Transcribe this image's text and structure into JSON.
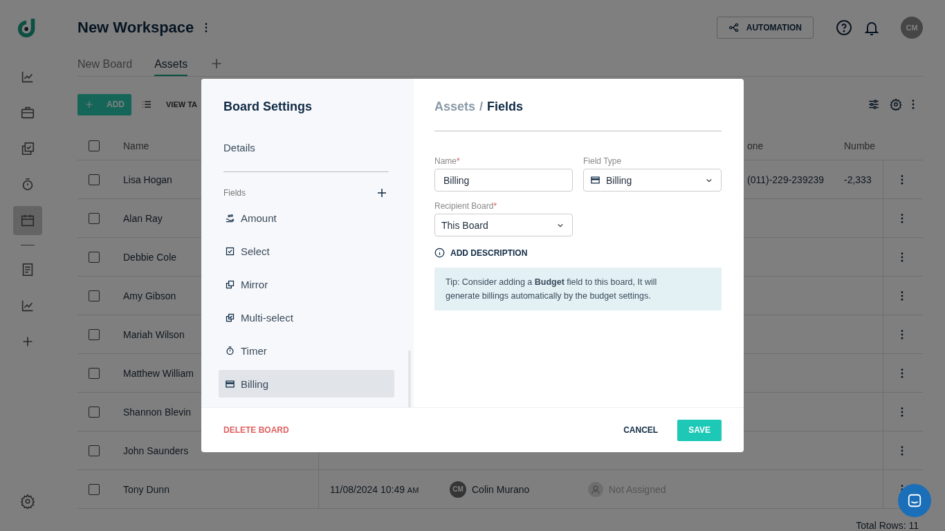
{
  "sidebar": {
    "items": [
      {
        "kind": "chart",
        "selected": false
      },
      {
        "kind": "briefcase",
        "selected": false
      },
      {
        "kind": "checklist",
        "selected": false
      },
      {
        "kind": "timer",
        "selected": false
      },
      {
        "kind": "calendar",
        "selected": true
      }
    ],
    "more_items": [
      {
        "kind": "document",
        "selected": false
      },
      {
        "kind": "chart",
        "selected": false
      },
      {
        "kind": "add",
        "selected": false
      }
    ]
  },
  "header": {
    "title": "New Workspace",
    "automation": "AUTOMATION",
    "avatar": "CM"
  },
  "tabs": [
    {
      "label": "New Board",
      "selected": false
    },
    {
      "label": "Assets",
      "selected": true
    }
  ],
  "toolbar": {
    "add": "ADD",
    "view": "VIEW TA"
  },
  "table": {
    "columns": [
      "Name",
      "one",
      "Numbe"
    ],
    "all_checked": false,
    "rows": [
      {
        "checked": false,
        "name": "Lisa Hogan",
        "phone": "(011)-229-239239",
        "number": "-2,333"
      },
      {
        "checked": false,
        "name": "Alan Ray"
      },
      {
        "checked": false,
        "name": "Debbie Cole"
      },
      {
        "checked": false,
        "name": "Amy Gibson"
      },
      {
        "checked": false,
        "name": "Mariah Wilson"
      },
      {
        "checked": false,
        "name": "Matthew William"
      },
      {
        "checked": false,
        "name": "Shannon Blevin"
      },
      {
        "checked": false,
        "name": "John Saunders"
      },
      {
        "checked": false,
        "name": "Tony Dunn",
        "date": "11/08/2024 10:49",
        "period": "AM",
        "creator_initials": "CM",
        "creator": "Colin Murano",
        "assignee": "Not Assigned"
      }
    ],
    "total": "Total Rows: 11"
  },
  "modal": {
    "title": "Board Settings",
    "nav": [
      "Details"
    ],
    "fields_label": "Fields",
    "fields": [
      {
        "label": "Amount",
        "kind": "amount",
        "selected": false
      },
      {
        "label": "Select",
        "kind": "select",
        "selected": false
      },
      {
        "label": "Mirror",
        "kind": "mirror",
        "selected": false
      },
      {
        "label": "Multi-select",
        "kind": "multiselect",
        "selected": false
      },
      {
        "label": "Timer",
        "kind": "timer",
        "selected": false
      },
      {
        "label": "Billing",
        "kind": "billing",
        "selected": true
      }
    ],
    "breadcrumb": {
      "parent": "Assets",
      "separator": "/",
      "current": "Fields"
    },
    "name_field": {
      "label": "Name",
      "required_mark": "*",
      "value": "Billing"
    },
    "type_field": {
      "label": "Field Type",
      "value": "Billing"
    },
    "recipient_field": {
      "label": "Recipient Board",
      "required_mark": "*",
      "value": "This Board"
    },
    "add_description": "ADD DESCRIPTION",
    "tip": "Tip: Consider adding a **Budget** field to this board, It will generate billings automatically by the budget settings.",
    "delete": "DELETE BOARD",
    "cancel": "CANCEL",
    "save": "SAVE"
  }
}
